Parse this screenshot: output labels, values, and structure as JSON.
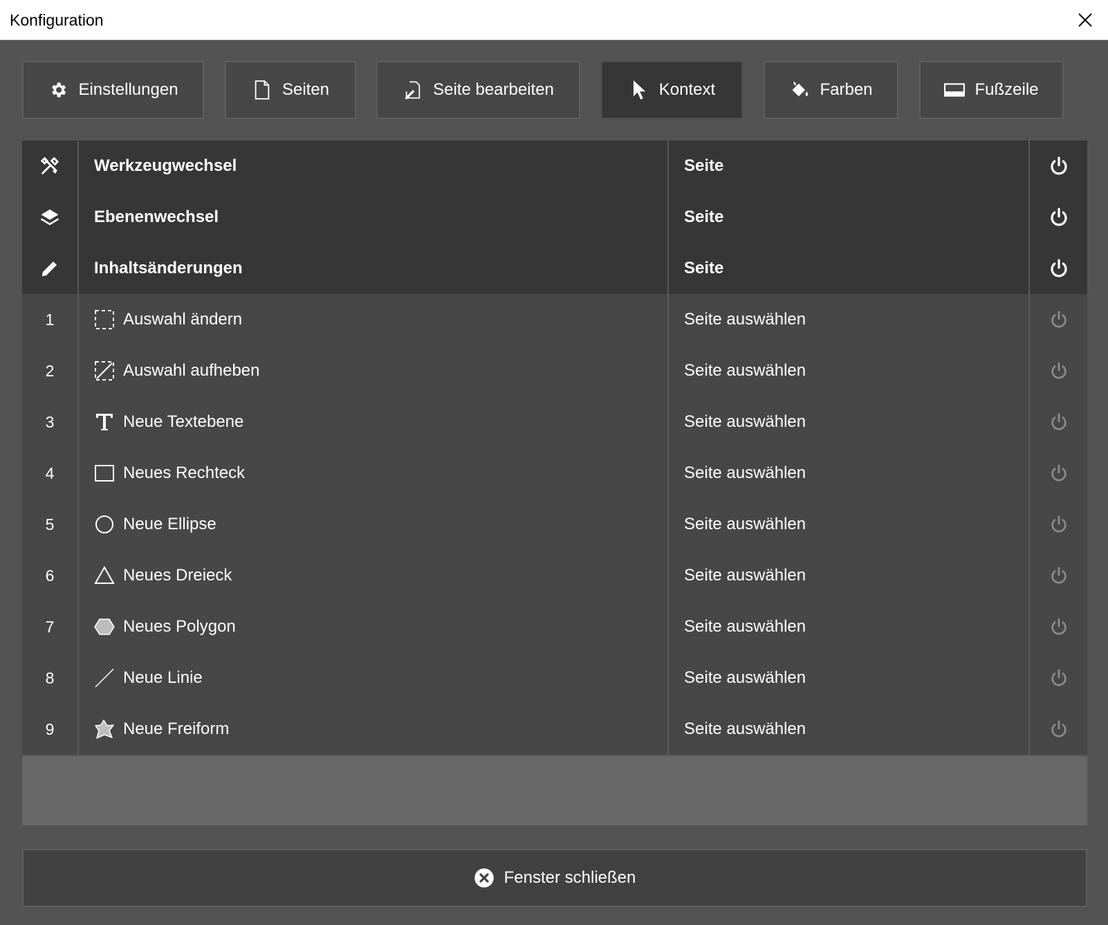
{
  "window": {
    "title": "Konfiguration",
    "close_icon": "close-icon"
  },
  "tabs": [
    {
      "label": "Einstellungen",
      "icon": "gear-icon"
    },
    {
      "label": "Seiten",
      "icon": "page-icon"
    },
    {
      "label": "Seite bearbeiten",
      "icon": "edit-page-icon"
    },
    {
      "label": "Kontext",
      "icon": "cursor-icon",
      "active": true
    },
    {
      "label": "Farben",
      "icon": "paint-bucket-icon"
    },
    {
      "label": "Fußzeile",
      "icon": "footer-icon"
    }
  ],
  "table": {
    "header_rows": [
      {
        "icon": "tools-icon",
        "name": "Werkzeugwechsel",
        "target": "Seite",
        "power": "power-icon"
      },
      {
        "icon": "layers-icon",
        "name": "Ebenenwechsel",
        "target": "Seite",
        "power": "power-icon"
      },
      {
        "icon": "pencil-icon",
        "name": "Inhaltsänderungen",
        "target": "Seite",
        "power": "power-icon"
      }
    ],
    "rows": [
      {
        "num": "1",
        "icon": "selection-icon",
        "name": "Auswahl ändern",
        "target": "Seite auswählen"
      },
      {
        "num": "2",
        "icon": "deselect-icon",
        "name": "Auswahl aufheben",
        "target": "Seite auswählen"
      },
      {
        "num": "3",
        "icon": "text-icon",
        "name": "Neue Textebene",
        "target": "Seite auswählen"
      },
      {
        "num": "4",
        "icon": "rectangle-icon",
        "name": "Neues Rechteck",
        "target": "Seite auswählen"
      },
      {
        "num": "5",
        "icon": "ellipse-icon",
        "name": "Neue Ellipse",
        "target": "Seite auswählen"
      },
      {
        "num": "6",
        "icon": "triangle-icon",
        "name": "Neues Dreieck",
        "target": "Seite auswählen"
      },
      {
        "num": "7",
        "icon": "polygon-icon",
        "name": "Neues Polygon",
        "target": "Seite auswählen"
      },
      {
        "num": "8",
        "icon": "line-icon",
        "name": "Neue Linie",
        "target": "Seite auswählen"
      },
      {
        "num": "9",
        "icon": "freeform-icon",
        "name": "Neue Freiform",
        "target": "Seite auswählen"
      }
    ]
  },
  "footer": {
    "close_label": "Fenster schließen",
    "icon": "close-circle-icon"
  },
  "colors": {
    "background": "#535353",
    "header_row": "#363636",
    "row": "#474747",
    "power_active": "#ffffff",
    "power_inactive": "#8a8a8a"
  }
}
